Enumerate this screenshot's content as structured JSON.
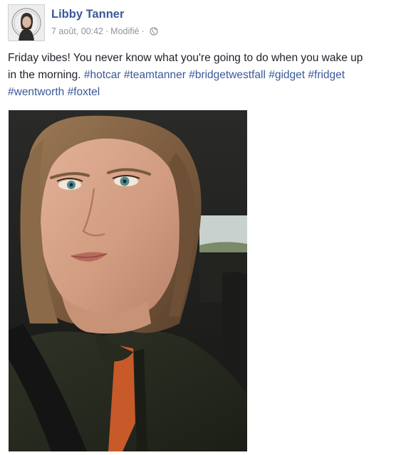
{
  "post": {
    "author": "Libby Tanner",
    "timestamp": "7 août, 00:42",
    "edited_label": "Modifié",
    "separator": "·",
    "privacy_icon": "globe-icon",
    "text_line1": "Friday vibes! You never know what you're going to do when you wake up",
    "text_line2_prefix": "in the morning.",
    "hashtags": [
      "#hotcar",
      "#teamtanner",
      "#bridgetwestfall",
      "#gidget",
      "#fridget",
      "#wentworth",
      "#foxtel"
    ]
  },
  "colors": {
    "link": "#3b5998",
    "meta": "#90949c",
    "text": "#1d2129"
  }
}
